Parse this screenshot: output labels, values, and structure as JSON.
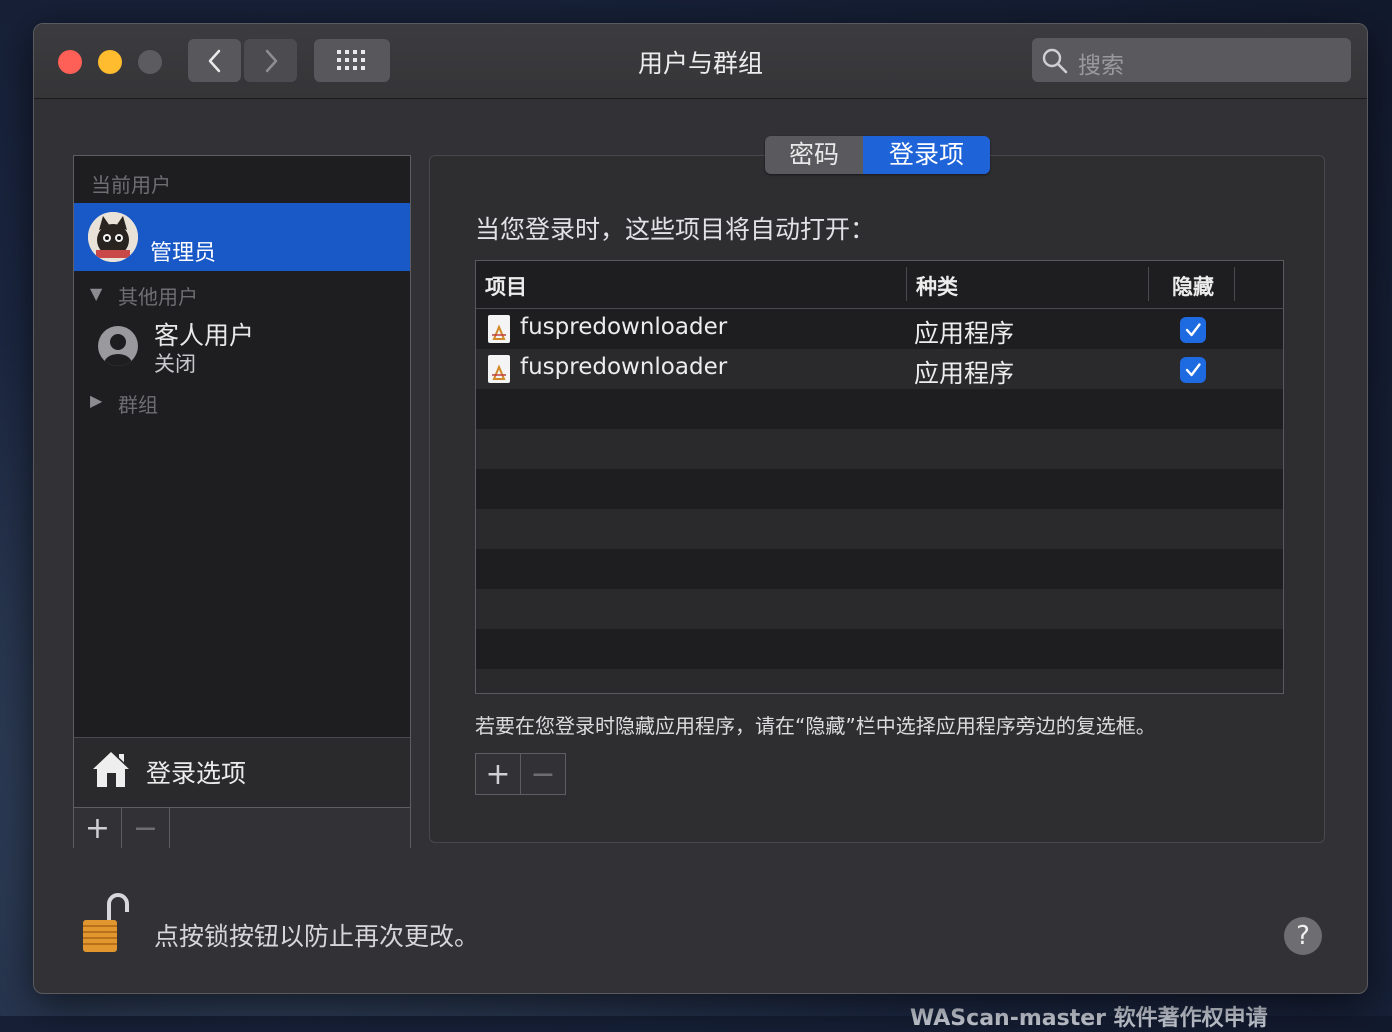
{
  "window": {
    "title": "用户与群组",
    "search_placeholder": "搜索"
  },
  "toolbar": {
    "back_icon": "chevron-left-icon",
    "forward_icon": "chevron-right-icon",
    "grid_icon": "grid-icon"
  },
  "sidebar": {
    "current_header": "当前用户",
    "current_user": {
      "name": "管理员"
    },
    "other_header": "其他用户",
    "guest": {
      "name": "客人用户",
      "status": "关闭"
    },
    "groups_header": "群组",
    "login_options": "登录选项",
    "add": "+",
    "remove": "−"
  },
  "tabs": [
    {
      "label": "密码",
      "selected": false
    },
    {
      "label": "登录项",
      "selected": true
    }
  ],
  "panel": {
    "intro": "当您登录时，这些项目将自动打开：",
    "columns": {
      "item": "项目",
      "kind": "种类",
      "hide": "隐藏"
    },
    "rows": [
      {
        "name": "fuspredownloader",
        "kind": "应用程序",
        "hidden": true
      },
      {
        "name": "fuspredownloader",
        "kind": "应用程序",
        "hidden": true
      }
    ],
    "hint": "若要在您登录时隐藏应用程序，请在“隐藏”栏中选择应用程序旁边的复选框。",
    "add": "+",
    "remove": "−"
  },
  "footer": {
    "lock_text": "点按锁按钮以防止再次更改。",
    "help": "?"
  },
  "backdrop": {
    "text": "WAScan-master 软件著作权申请"
  },
  "colors": {
    "accent": "#1958c7",
    "checkbox": "#1e6ae0",
    "close": "#fe5f57",
    "minimize": "#febc2e",
    "zoom_disabled": "#5c5c60"
  }
}
